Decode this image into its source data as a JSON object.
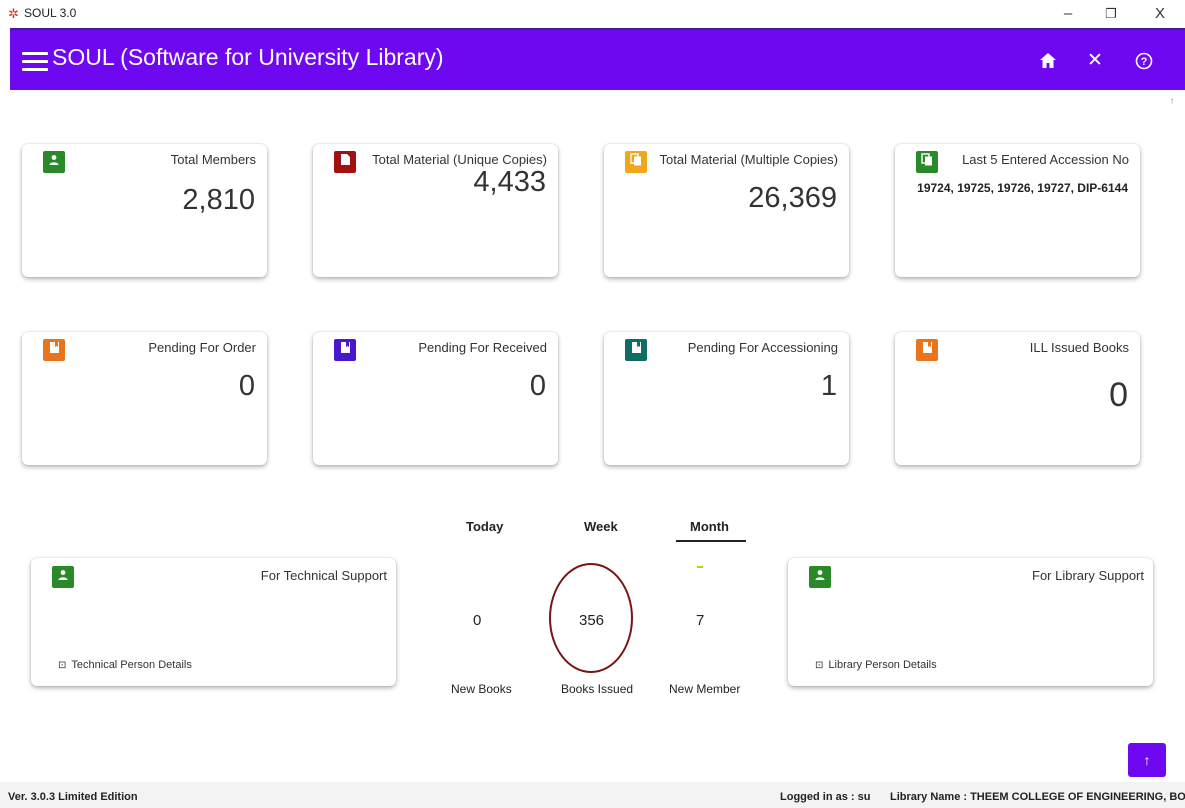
{
  "window": {
    "title": "SOUL 3.0",
    "controls": {
      "minimize": "–",
      "restore": "❐",
      "close": "X"
    }
  },
  "header": {
    "title": "SOUL (Software for University Library)",
    "background": "#6e08f0",
    "icons": [
      "menu-icon",
      "home-icon",
      "close-icon",
      "help-icon"
    ]
  },
  "cards": [
    {
      "label": "Total Members",
      "value": "2,810",
      "icon": "member-icon",
      "color": "#2a8a2a"
    },
    {
      "label": "Total Material (Unique Copies)",
      "value": "4,433",
      "icon": "document-icon",
      "color": "#a31010"
    },
    {
      "label": "Total Material (Multiple Copies)",
      "value": "26,369",
      "icon": "copies-icon",
      "color": "#f0a818"
    },
    {
      "label": "Last 5 Entered Accession No",
      "value": "19724, 19725, 19726, 19727, DIP-6144",
      "icon": "copies-icon",
      "color": "#2a8a2a"
    },
    {
      "label": "Pending For Order",
      "value": "0",
      "icon": "book-icon",
      "color": "#e8741c"
    },
    {
      "label": "Pending For Received",
      "value": "0",
      "icon": "book-icon",
      "color": "#4a18c8"
    },
    {
      "label": "Pending For Accessioning",
      "value": "1",
      "icon": "book-icon",
      "color": "#0d6e63"
    },
    {
      "label": "ILL Issued Books",
      "value": "0",
      "icon": "book-icon",
      "color": "#e8741c"
    }
  ],
  "period_tabs": {
    "today": "Today",
    "week": "Week",
    "month": "Month",
    "selected": "Month"
  },
  "stats": {
    "new_books": {
      "value": "0",
      "label": "New Books"
    },
    "books_issued": {
      "value": "356",
      "label": "Books Issued"
    },
    "new_member": {
      "value": "7",
      "label": "New Member"
    }
  },
  "support": {
    "technical": {
      "label": "For Technical Support",
      "link": "Technical Person Details"
    },
    "library": {
      "label": "For Library Support",
      "link": "Library Person Details"
    }
  },
  "statusbar": {
    "version": "Ver. 3.0.3  Limited Edition",
    "logged_in": "Logged in as : su",
    "library_name": "Library Name : THEEM COLLEGE OF ENGINEERING, BOISAR"
  }
}
